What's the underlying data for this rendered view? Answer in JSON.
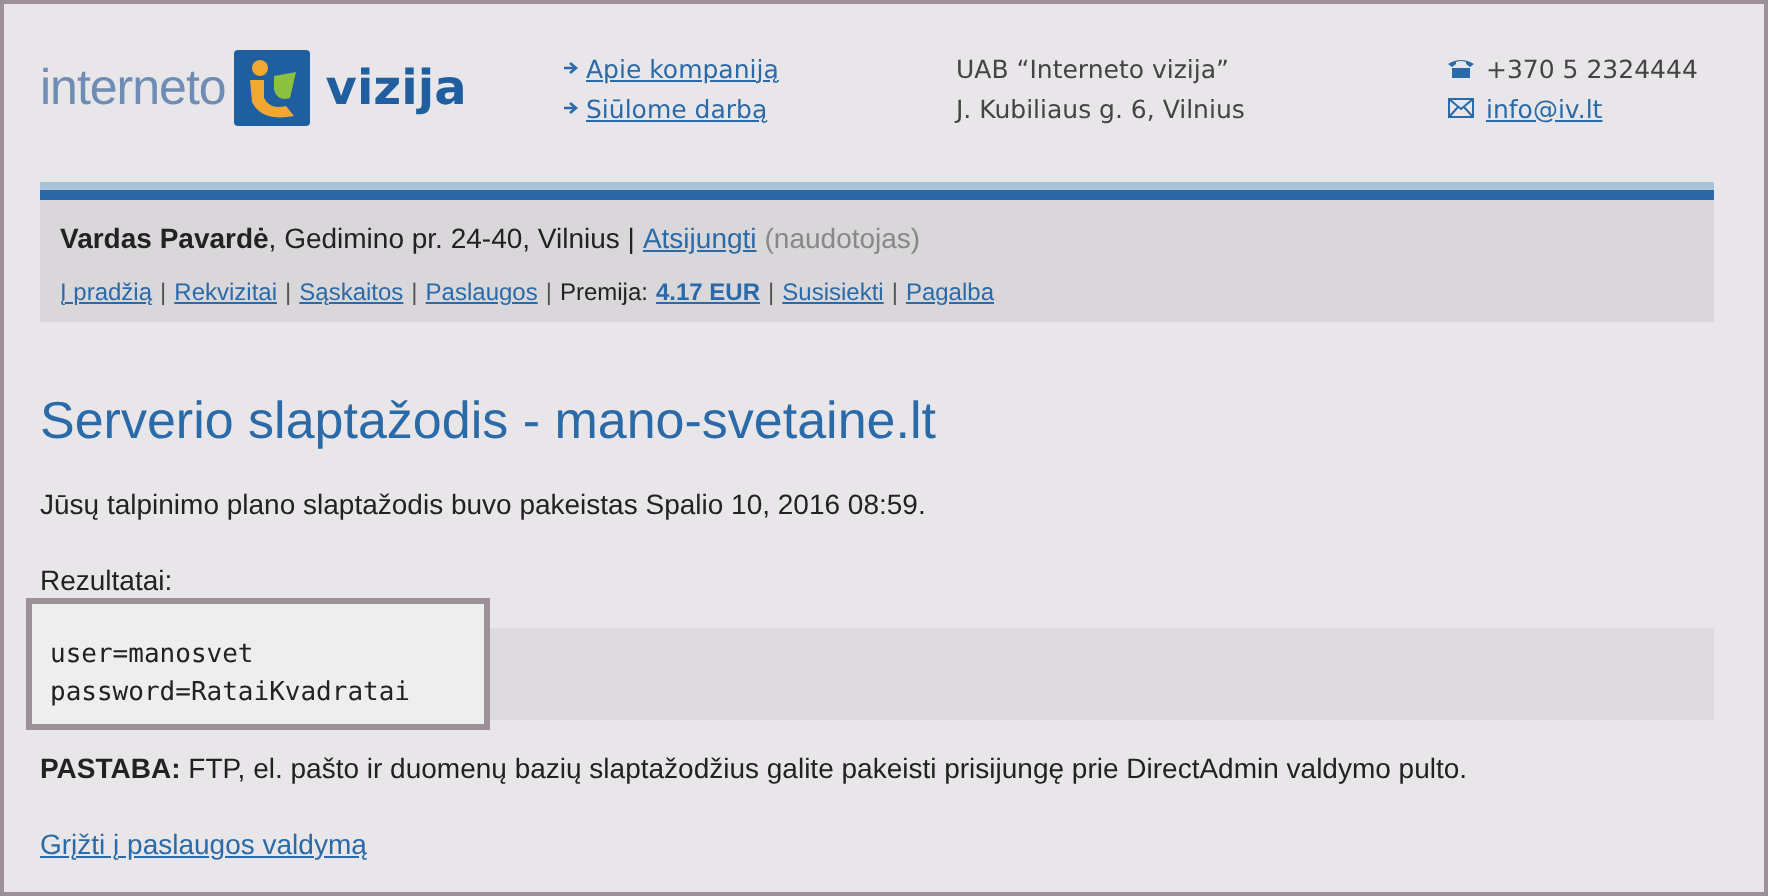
{
  "header": {
    "logo": {
      "left": "interneto",
      "right": "vizija"
    },
    "nav_links": [
      "Apie kompaniją",
      "Siūlome darbą"
    ],
    "company": [
      "UAB “Interneto vizija”",
      "J. Kubiliaus g. 6, Vilnius"
    ],
    "phone": "+370 5 2324444",
    "email": "info@iv.lt"
  },
  "user_bar": {
    "user": "**Vardas Pavardė**, Gedimino pr. 24-40, Vilnius |",
    "logout": "Atsijungti",
    "role": "(naudotojas)"
  },
  "menu": [
    {
      "kind": "link",
      "text": "Į pradžią"
    },
    {
      "kind": "separator",
      "text": "|"
    },
    {
      "kind": "link",
      "text": "Rekvizitai"
    },
    {
      "kind": "separator",
      "text": "|"
    },
    {
      "kind": "link",
      "text": "Sąskaitos"
    },
    {
      "kind": "separator",
      "text": "|"
    },
    {
      "kind": "link",
      "text": "Paslaugos"
    },
    {
      "kind": "separator",
      "text": "|"
    },
    {
      "kind": "text",
      "text": "Premija:"
    },
    {
      "kind": "strong-link",
      "text": "4.17 EUR"
    },
    {
      "kind": "separator",
      "text": "|"
    },
    {
      "kind": "link",
      "text": "Susisiekti"
    },
    {
      "kind": "separator",
      "text": "|"
    },
    {
      "kind": "link",
      "text": "Pagalba"
    }
  ],
  "title": "Serverio slaptažodis - mano-svetaine.lt",
  "message": "Jūsų talpinimo plano slaptažodis buvo pakeistas Spalio 10, 2016 08:59.",
  "results_label": "Rezultatai:",
  "results": [
    "user=manosvet",
    "password=RataiKvadratai"
  ],
  "note": "**PASTABA:** FTP, el. pašto ir duomenų bazių slaptažodžius galite pakeisti prisijungę prie DirectAdmin valdymo pulto.",
  "back_link": "Grįžti į paslaugos valdymą"
}
